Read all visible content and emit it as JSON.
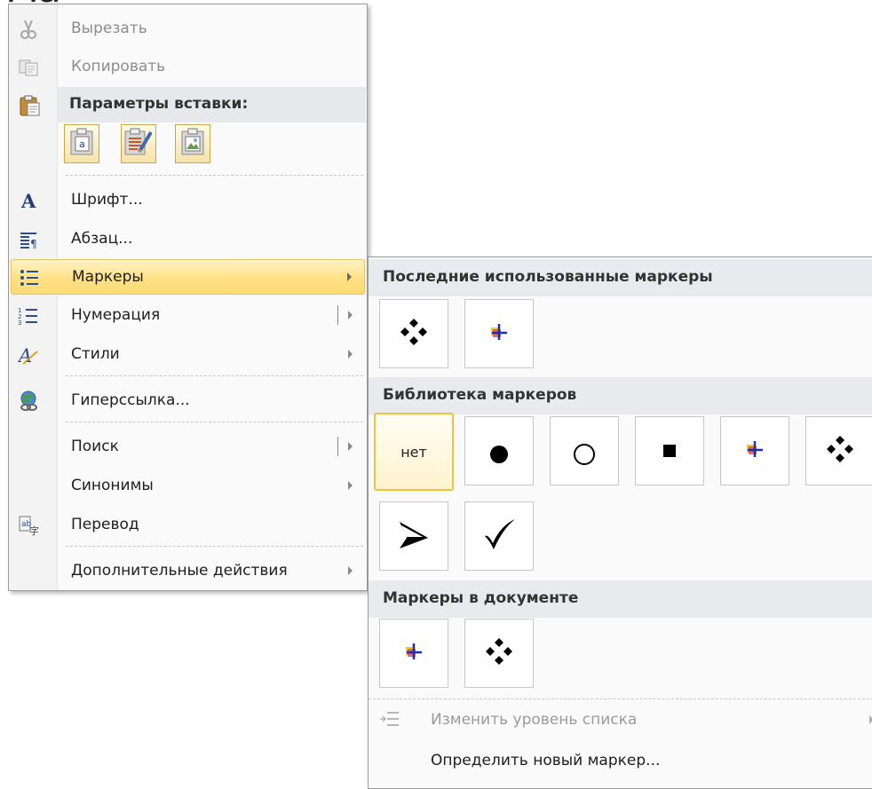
{
  "context_menu": {
    "cut": "Вырезать",
    "copy": "Копировать",
    "paste_options": "Параметры вставки:",
    "font": "Шрифт...",
    "paragraph": "Абзац...",
    "bullets": "Маркеры",
    "numbering": "Нумерация",
    "styles": "Стили",
    "hyperlink": "Гиперссылка...",
    "search": "Поиск",
    "synonyms": "Синонимы",
    "translate": "Перевод",
    "more_actions": "Дополнительные действия"
  },
  "bullets_flyout": {
    "recent_header": "Последние использованные маркеры",
    "library_header": "Библиотека маркеров",
    "document_header": "Маркеры в документе",
    "none_label": "нет",
    "change_level": "Изменить уровень списка",
    "define_new": "Определить новый маркер..."
  },
  "colors": {
    "accent_hover": "#ffe184",
    "selected_border": "#f0c33c",
    "header_band": "#e9eaee"
  },
  "icons": {
    "cut": "scissors-icon",
    "copy": "copy-icon",
    "paste": "clipboard-icon",
    "font": "font-a-icon",
    "paragraph": "paragraph-icon",
    "bullets": "bullet-list-icon",
    "numbering": "numbered-list-icon",
    "styles": "styles-icon",
    "hyperlink": "globe-link-icon",
    "translate": "translate-icon"
  }
}
